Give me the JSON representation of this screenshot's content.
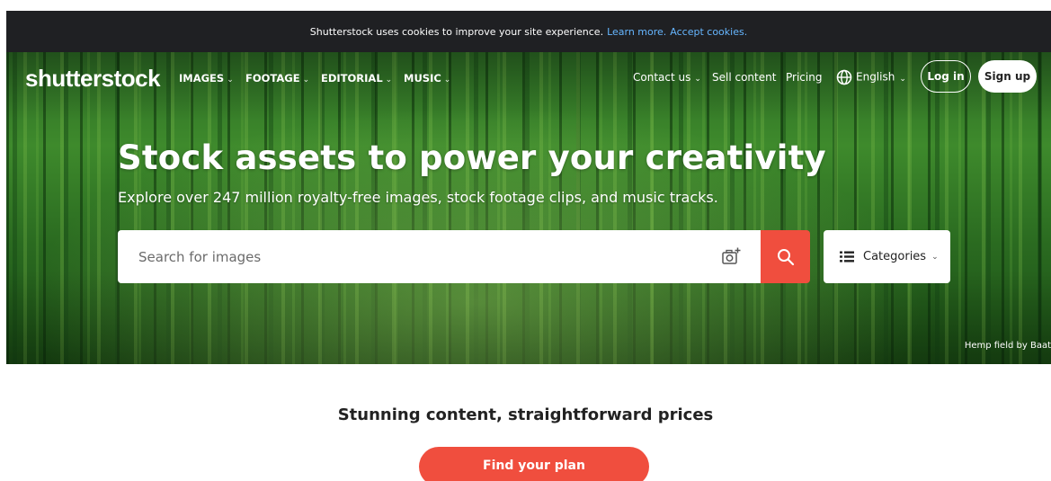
{
  "cookie": {
    "text": "Shutterstock uses cookies to improve your site experience.",
    "learn_more": "Learn more.",
    "accept": "Accept cookies."
  },
  "nav": {
    "logo": "shutterstock",
    "items": [
      "IMAGES",
      "FOOTAGE",
      "EDITORIAL",
      "MUSIC"
    ],
    "contact": "Contact us",
    "sell": "Sell content",
    "pricing": "Pricing",
    "language": "English",
    "login": "Log in",
    "signup": "Sign up"
  },
  "hero": {
    "headline": "Stock assets to power your creativity",
    "subhead": "Explore over 247 million royalty-free images, stock footage clips, and music tracks.",
    "search_placeholder": "Search for images",
    "categories_label": "Categories",
    "credit": "Hemp field by Baat"
  },
  "pricing": {
    "title": "Stunning content, straightforward prices",
    "cta": "Find your plan"
  },
  "colors": {
    "accent": "#f04e3e",
    "link": "#66b6ff",
    "cookie_bg": "#1f2023"
  },
  "icons": [
    "camera-search-icon",
    "search-icon",
    "list-icon",
    "globe-icon",
    "chevron-down-icon"
  ]
}
